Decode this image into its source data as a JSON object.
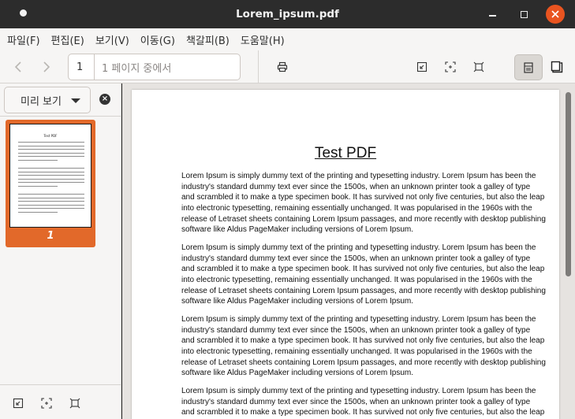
{
  "window": {
    "title": "Lorem_ipsum.pdf"
  },
  "menu": [
    "파일(F)",
    "편집(E)",
    "보기(V)",
    "이동(G)",
    "책갈피(B)",
    "도움말(H)"
  ],
  "toolbar": {
    "page_number": "1",
    "page_label": "1 페이지 중에서"
  },
  "sidebar": {
    "view_mode": "미리 보기",
    "thumbnail_label": "1",
    "thumbnail_title": "Test PDF"
  },
  "document": {
    "title": "Test PDF",
    "paragraph_lines": [
      "Lorem Ipsum is simply dummy text of the printing and typesetting industry. Lorem Ipsum has been the",
      "industry's standard dummy text ever since the 1500s, when an unknown printer took a galley of type",
      "and scrambled it to make a type specimen book. It has survived not only five centuries, but also the leap",
      "into electronic typesetting, remaining essentially unchanged. It was popularised in the 1960s with the",
      "release of Letraset sheets containing Lorem Ipsum passages, and more recently with desktop publishing",
      "software like Aldus PageMaker including versions of Lorem Ipsum."
    ]
  },
  "colors": {
    "accent": "#e2692a",
    "close_button": "#e95420",
    "titlebar": "#2c2c2c"
  }
}
